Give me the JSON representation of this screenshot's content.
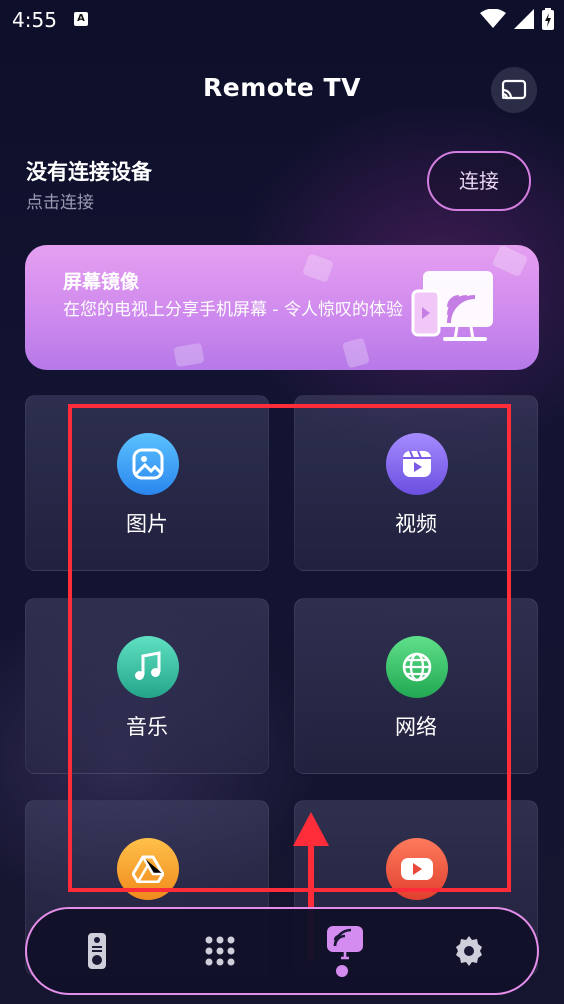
{
  "status_bar": {
    "time": "4:55",
    "notif_letter": "A"
  },
  "header": {
    "title": "Remote TV"
  },
  "connection": {
    "title": "没有连接设备",
    "subtitle": "点击连接",
    "button_label": "连接"
  },
  "banner": {
    "title": "屏幕镜像",
    "description": "在您的电视上分享手机屏幕 - 令人惊叹的体验"
  },
  "grid": {
    "items": [
      {
        "label": "图片",
        "icon": "photo-icon",
        "color": "#3aa6f5"
      },
      {
        "label": "视频",
        "icon": "video-icon",
        "color": "#8a6cf0"
      },
      {
        "label": "音乐",
        "icon": "music-icon",
        "color": "#39c6a8"
      },
      {
        "label": "网络",
        "icon": "globe-icon",
        "color": "#3cc96a"
      },
      {
        "label": "",
        "icon": "drive-icon",
        "color": "#f7a236"
      },
      {
        "label": "",
        "icon": "youtube-icon",
        "color": "#f0533f"
      }
    ]
  },
  "nav": {
    "items": [
      {
        "icon": "remote-icon",
        "active": false
      },
      {
        "icon": "keypad-icon",
        "active": false
      },
      {
        "icon": "screen-cast-icon",
        "active": true
      },
      {
        "icon": "settings-icon",
        "active": false
      }
    ]
  },
  "colors": {
    "accent": "#d58cf0",
    "annotation": "#ff2c3a"
  }
}
